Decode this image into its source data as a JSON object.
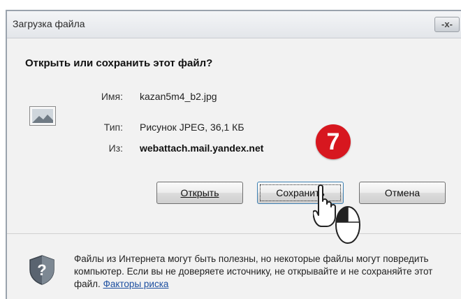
{
  "dialog": {
    "title": "Загрузка файла",
    "close_label": "-x-",
    "question": "Открыть или сохранить этот файл?"
  },
  "file": {
    "name_label": "Имя:",
    "name_value": "kazan5m4_b2.jpg",
    "type_label": "Тип:",
    "type_value": "Рисунок JPEG, 36,1 КБ",
    "from_label": "Из:",
    "from_value": "webattach.mail.yandex.net"
  },
  "buttons": {
    "open": "Открыть",
    "save": "Сохранить",
    "cancel": "Отмена"
  },
  "step_badge": "7",
  "warning": {
    "text": "Файлы из Интернета могут быть полезны, но некоторые файлы могут повредить компьютер. Если вы не доверяете источнику, не открывайте и не сохраняйте этот файл.",
    "link": "Факторы риска"
  },
  "colors": {
    "badge": "#d7171f",
    "link": "#1d4fa0",
    "button_focus": "#3c7fb1"
  },
  "icons": [
    "image-file-icon",
    "close-icon",
    "hand-cursor-icon",
    "mouse-icon",
    "shield-question-icon"
  ]
}
